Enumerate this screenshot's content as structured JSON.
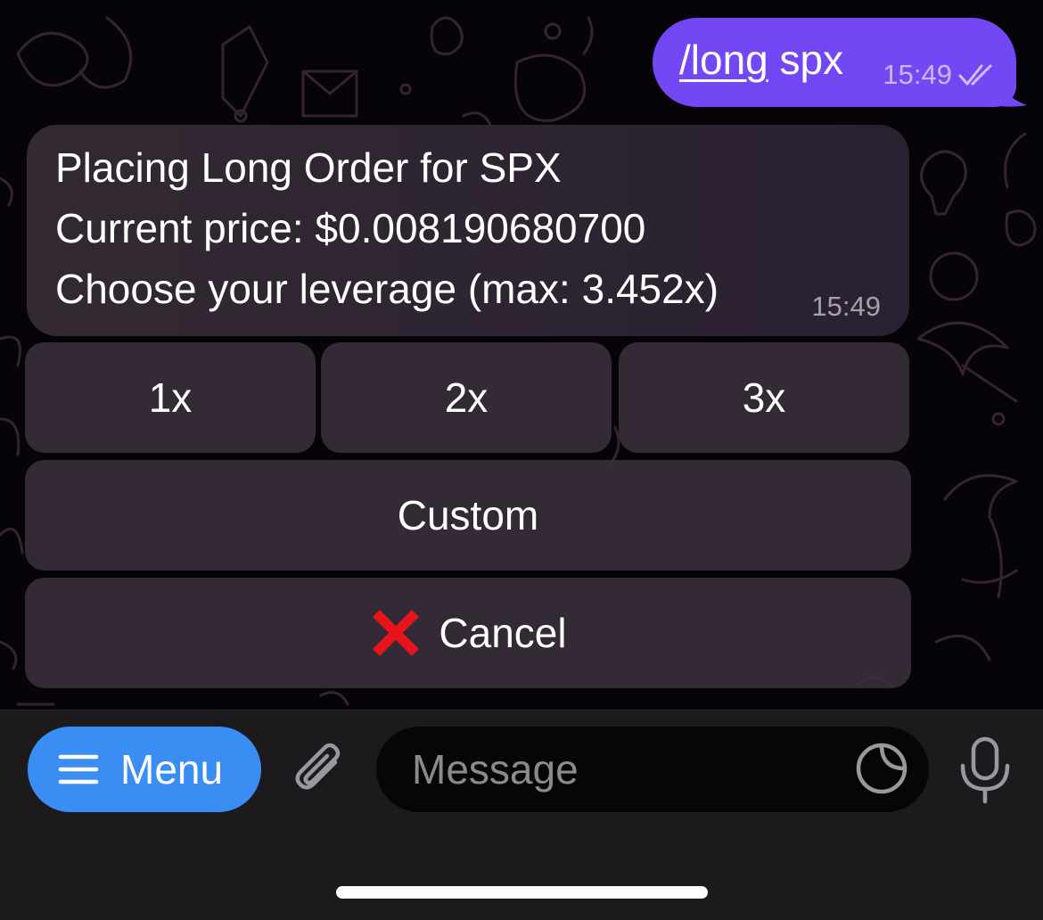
{
  "outgoing_message": {
    "command": "/long",
    "argument": " spx",
    "time": "15:49",
    "status_icon": "double-check-icon"
  },
  "incoming_message": {
    "lines": [
      "Placing Long Order for SPX",
      "Current price: $0.008190680700",
      "Choose your leverage (max: 3.452x)"
    ],
    "time": "15:49"
  },
  "keyboard": {
    "row1": [
      "1x",
      "2x",
      "3x"
    ],
    "custom_label": "Custom",
    "cancel_label": "Cancel",
    "cancel_icon": "red-cross-mark-icon"
  },
  "input_bar": {
    "menu_label": "Menu",
    "menu_icon": "hamburger-icon",
    "attach_icon": "paperclip-icon",
    "placeholder": "Message",
    "sticker_icon": "sticker-icon",
    "mic_icon": "microphone-icon"
  },
  "colors": {
    "outgoing_bubble": "#7447f5",
    "menu_button": "#3a8ef3",
    "cancel_icon": "#e8141c"
  }
}
